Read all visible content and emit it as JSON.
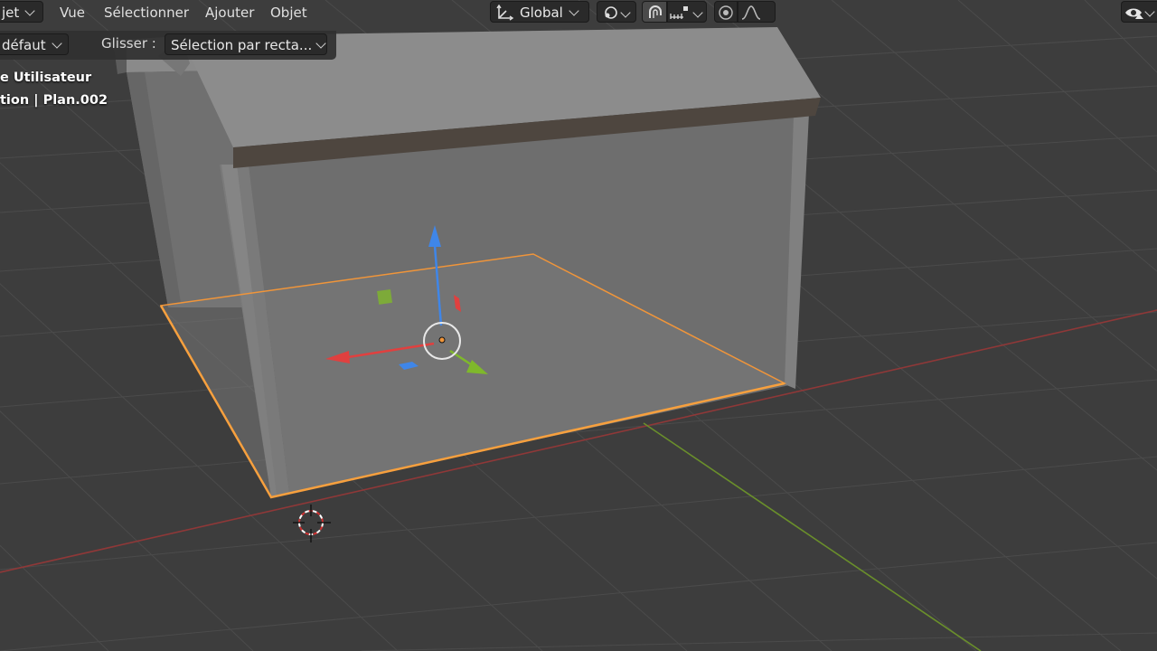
{
  "header": {
    "mode_label": "jet",
    "menus": [
      "Vue",
      "Sélectionner",
      "Ajouter",
      "Objet"
    ],
    "orientation_label": "Global"
  },
  "toolbar": {
    "orientation_partial": "défaut",
    "drag_label": "Glisser :",
    "drag_value": "Sélection par recta..."
  },
  "viewport_overlay": {
    "view_name": "e Utilisateur",
    "collection_info": "tion | Plan.002"
  },
  "colors": {
    "background": "#3d3d3d",
    "selection_outline": "#f0953a",
    "axis_x": "#e0403f",
    "axis_y": "#7fb82b",
    "axis_z": "#3f86e8"
  },
  "icons": [
    "chevron-down-icon",
    "transform-orientation-icon",
    "pivot-point-icon",
    "snap-icon",
    "snap-increment-icon",
    "proportional-edit-icon",
    "falloff-curve-icon",
    "visibility-eye-icon",
    "3d-cursor-icon",
    "gizmo-origin-icon"
  ]
}
